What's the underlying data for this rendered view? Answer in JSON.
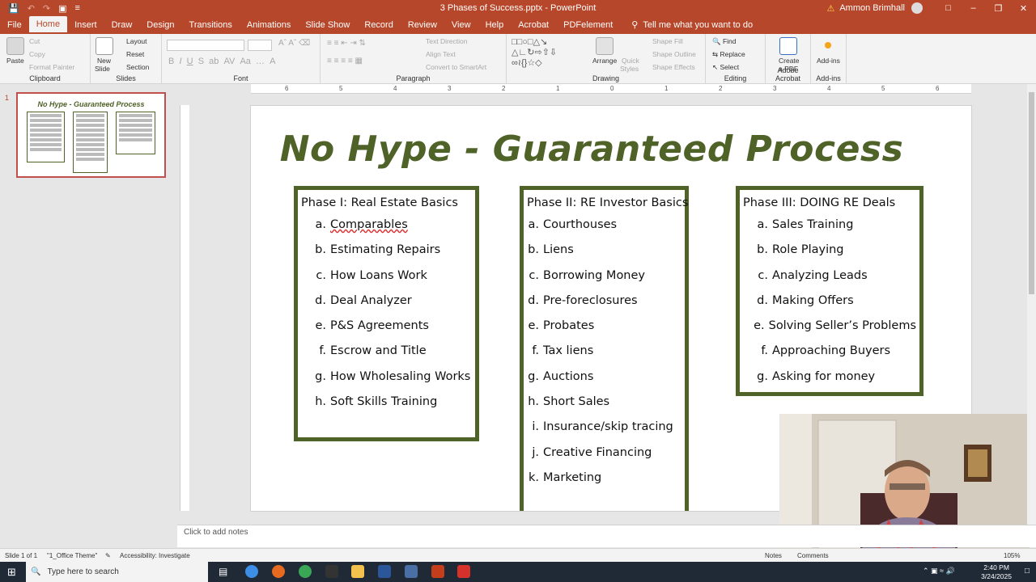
{
  "window": {
    "title": "3 Phases of Success.pptx - PowerPoint",
    "user": "Ammon Brimhall",
    "autosave_icon": "save-icon"
  },
  "tabs": [
    "File",
    "Home",
    "Insert",
    "Draw",
    "Design",
    "Transitions",
    "Animations",
    "Slide Show",
    "Record",
    "Review",
    "View",
    "Help",
    "Acrobat",
    "PDFelement"
  ],
  "active_tab": "Home",
  "tell_me": "Tell me what you want to do",
  "ribbon": {
    "clipboard": {
      "label": "Clipboard",
      "paste": "Paste",
      "cut": "Cut",
      "copy": "Copy",
      "format_painter": "Format Painter"
    },
    "slides": {
      "label": "Slides",
      "new_slide": "New",
      "new_slide2": "Slide",
      "layout": "Layout",
      "reset": "Reset",
      "section": "Section"
    },
    "font": {
      "label": "Font"
    },
    "paragraph": {
      "label": "Paragraph",
      "text_direction": "Text Direction",
      "align_text": "Align Text",
      "convert_smartart": "Convert to SmartArt"
    },
    "drawing": {
      "label": "Drawing",
      "arrange": "Arrange",
      "quick_styles": "Quick",
      "quick_styles2": "Styles",
      "shape_fill": "Shape Fill",
      "shape_outline": "Shape Outline",
      "shape_effects": "Shape Effects"
    },
    "editing": {
      "label": "Editing",
      "find": "Find",
      "replace": "Replace",
      "select": "Select"
    },
    "acrobat": {
      "label": "Adobe Acrobat",
      "create_pdf": "Create",
      "create_pdf2": "a PDF"
    },
    "addins": {
      "label": "Add-ins",
      "addins": "Add-ins"
    }
  },
  "thumbnail": {
    "number": "1",
    "title": "No Hype - Guaranteed Process"
  },
  "ruler": [
    "6",
    "5",
    "4",
    "3",
    "2",
    "1",
    "0",
    "1",
    "2",
    "3",
    "4",
    "5",
    "6"
  ],
  "slide": {
    "title": "No Hype - Guaranteed Process",
    "phases": [
      {
        "heading": "Phase I: Real Estate Basics",
        "items": [
          {
            "marker": "a.",
            "text": "Comparables"
          },
          {
            "marker": "b.",
            "text": "Estimating Repairs"
          },
          {
            "marker": "c.",
            "text": "How Loans Work"
          },
          {
            "marker": "d.",
            "text": "Deal Analyzer"
          },
          {
            "marker": "e.",
            "text": "P&S Agreements"
          },
          {
            "marker": "f.",
            "text": "Escrow and Title"
          },
          {
            "marker": "g.",
            "text": "How Wholesaling Works"
          },
          {
            "marker": "h.",
            "text": "Soft Skills Training"
          }
        ]
      },
      {
        "heading": "Phase II: RE Investor Basics",
        "items": [
          {
            "marker": "a.",
            "text": "Courthouses"
          },
          {
            "marker": "b.",
            "text": "Liens"
          },
          {
            "marker": "c.",
            "text": "Borrowing Money"
          },
          {
            "marker": "d.",
            "text": "Pre-foreclosures"
          },
          {
            "marker": "e.",
            "text": "Probates"
          },
          {
            "marker": "f.",
            "text": "Tax liens"
          },
          {
            "marker": "g.",
            "text": "Auctions"
          },
          {
            "marker": "h.",
            "text": "Short Sales"
          },
          {
            "marker": "i.",
            "text": "Insurance/skip tracing"
          },
          {
            "marker": "j.",
            "text": "Creative Financing"
          },
          {
            "marker": "k.",
            "text": "Marketing"
          }
        ]
      },
      {
        "heading": "Phase III: DOING RE Deals",
        "items": [
          {
            "marker": "a.",
            "text": "Sales Training"
          },
          {
            "marker": "b.",
            "text": "Role Playing"
          },
          {
            "marker": "c.",
            "text": "Analyzing Leads"
          },
          {
            "marker": "d.",
            "text": "Making Offers"
          },
          {
            "marker": "e.",
            "text": "Solving Seller’s Problems"
          },
          {
            "marker": "f.",
            "text": "Approaching Buyers"
          },
          {
            "marker": "g.",
            "text": "Asking for money"
          }
        ]
      }
    ]
  },
  "notes_placeholder": "Click to add notes",
  "status": {
    "slide": "Slide 1 of 1",
    "theme": "\"1_Office Theme\"",
    "accessibility": "Accessibility: Investigate",
    "notes": "Notes",
    "comments": "Comments",
    "zoom": "105%"
  },
  "taskbar": {
    "search_placeholder": "Type here to search",
    "time": "2:40 PM",
    "date": "3/24/2025"
  },
  "colors": {
    "accent": "#b7472a",
    "slide_green": "#4f6228"
  }
}
